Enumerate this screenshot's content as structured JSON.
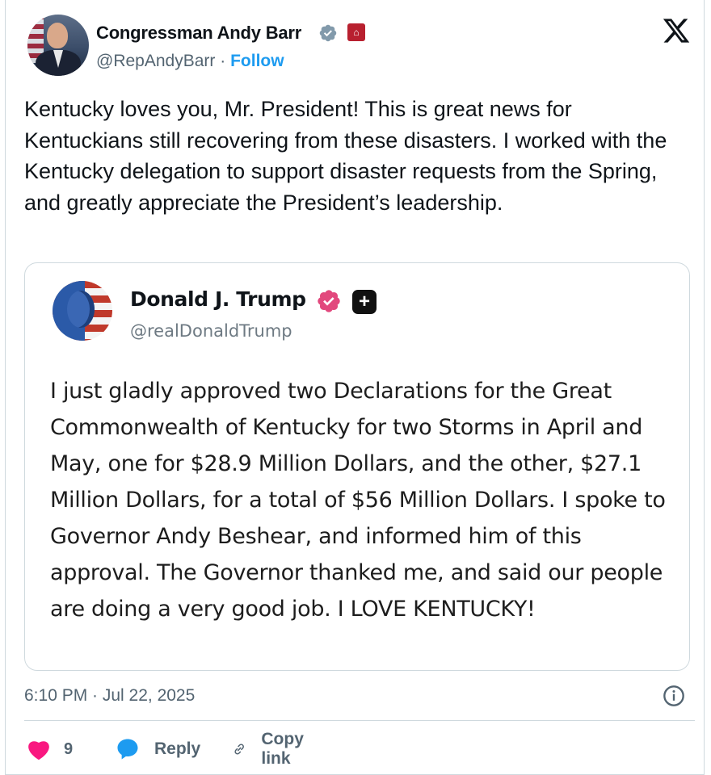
{
  "author": {
    "name": "Congressman Andy Barr",
    "handle": "@RepAndyBarr",
    "separator": "·",
    "follow_label": "Follow",
    "verified_icon": "gray-verified-badge-icon",
    "affiliation_icon": "us-capitol-badge-icon"
  },
  "tweet": {
    "text": "Kentucky loves you, Mr. President! This is great news for Kentuckians still recovering from these disasters. I worked with the Kentucky delegation to support disaster requests from the Spring, and greatly appreciate the President’s leadership.",
    "timestamp": "6:10 PM · Jul 22, 2025"
  },
  "quoted_post": {
    "name": "Donald J. Trump",
    "handle": "@realDonaldTrump",
    "verified_icon": "pink-verified-badge-icon",
    "platform_icon": "truth-social-plus-icon",
    "text": "I just gladly approved two Declarations for the Great Commonwealth of Kentucky for two Storms in April and May, one for $28.9 Million Dollars, and the other, $27.1 Million Dollars, for a total of $56 Million Dollars. I spoke to Governor Andy Beshear, and informed him of this approval. The Governor thanked me, and said our people are doing a very good job. I LOVE KENTUCKY!"
  },
  "actions": {
    "like_count": "9",
    "reply_label": "Reply",
    "copy_link_label": "Copy link"
  },
  "colors": {
    "accent": "#1d9bf0",
    "like": "#f91880",
    "muted_text": "#536471",
    "border": "#cfd9de"
  }
}
